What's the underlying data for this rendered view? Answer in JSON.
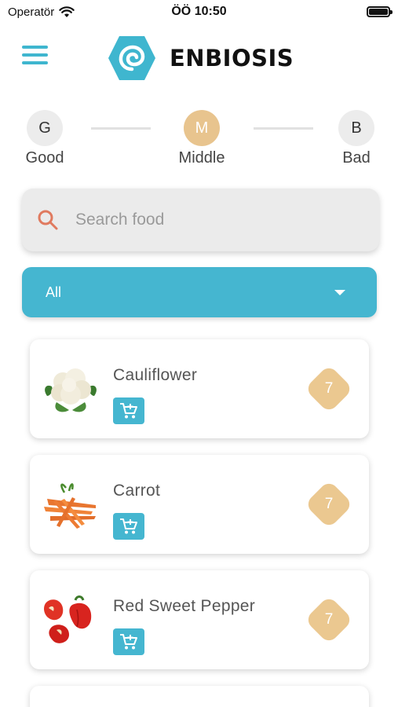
{
  "status_bar": {
    "carrier": "Operatör",
    "time": "ÖÖ 10:50"
  },
  "header": {
    "brand": "ENBIOSIS"
  },
  "stepper": {
    "steps": [
      {
        "letter": "G",
        "label": "Good"
      },
      {
        "letter": "M",
        "label": "Middle"
      },
      {
        "letter": "B",
        "label": "Bad"
      }
    ],
    "active_index": 1
  },
  "search": {
    "placeholder": "Search food",
    "value": ""
  },
  "filter": {
    "selected": "All"
  },
  "foods": [
    {
      "name": "Cauliflower",
      "score": "7"
    },
    {
      "name": "Carrot",
      "score": "7"
    },
    {
      "name": "Red Sweet Pepper",
      "score": "7"
    },
    {
      "name": "",
      "score": ""
    }
  ],
  "colors": {
    "accent": "#45b6d0",
    "score": "#ebc890",
    "active_step": "#e8c48e"
  },
  "icons": {
    "menu": "hamburger-icon",
    "search": "search-icon",
    "dropdown": "chevron-down-icon",
    "cart": "add-to-cart-icon",
    "wifi": "wifi-icon",
    "battery": "battery-icon"
  }
}
